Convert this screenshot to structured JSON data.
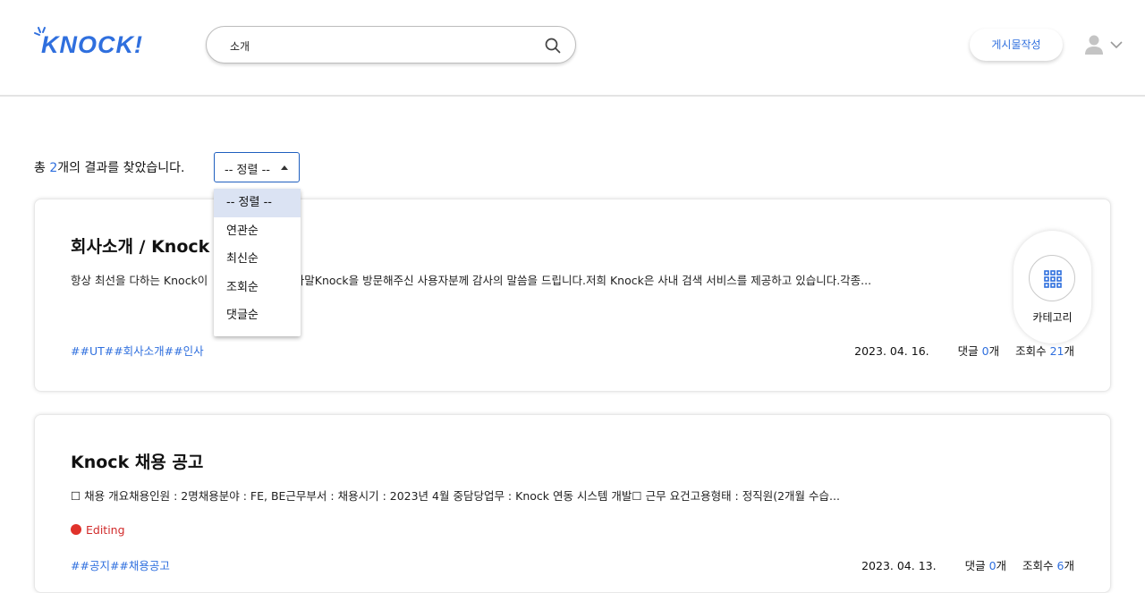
{
  "header": {
    "logo_text": "KNOCK!",
    "search": {
      "value": "소개"
    },
    "write_button": "게시물작성"
  },
  "results": {
    "prefix": "총 ",
    "count": "2",
    "suffix": "개의 결과를 찾았습니다."
  },
  "sort": {
    "selected": "-- 정렬 --",
    "options": [
      "-- 정렬 --",
      "연관순",
      "최신순",
      "조회순",
      "댓글순"
    ]
  },
  "category_button": {
    "label": "카테고리"
  },
  "posts": [
    {
      "title": "회사소개 / Knock",
      "body_start": "항상 최선을 다하는 Knock이",
      "body_end": ".직원 인사말Knock을 방문해주신 사용자분께 감사의 말씀을 드립니다.저희 Knock은 사내 검색 서비스를 제공하고 있습니다.각종...",
      "tags": "##UT##회사소개##인사",
      "date": "2023. 04. 16.",
      "comments_label": "댓글",
      "comments": "0",
      "comments_unit": "개",
      "views_label": "조회수",
      "views": "21",
      "views_unit": "개"
    },
    {
      "title": "Knock 채용 공고",
      "body": "☐ 채용 개요채용인원 : 2명채용분야 : FE, BE근무부서 : 채용시기 : 2023년 4월 중담당업무 : Knock 연동 시스템 개발☐ 근무 요건고용형태 : 정직원(2개월 수습...",
      "status": "Editing",
      "tags": "##공지##채용공고",
      "date": "2023. 04. 13.",
      "comments_label": "댓글",
      "comments": "0",
      "comments_unit": "개",
      "views_label": "조회수",
      "views": "6",
      "views_unit": "개"
    }
  ],
  "colors": {
    "accent": "#2f6fde",
    "editing_dot": "#e0322b",
    "dropdown_selected": "#dbe3f3"
  }
}
